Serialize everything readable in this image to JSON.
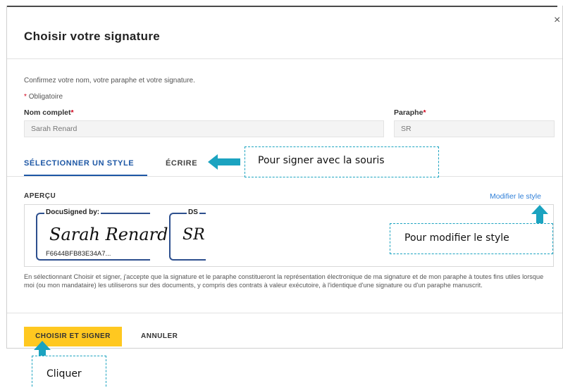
{
  "dialog": {
    "title": "Choisir votre signature",
    "close_symbol": "×",
    "intro": "Confirmez votre nom, votre paraphe et votre signature.",
    "required_star": "*",
    "required_label": "Obligatoire"
  },
  "form": {
    "fullname_label": "Nom complet",
    "fullname_value": "Sarah Renard",
    "initials_label": "Paraphe",
    "initials_value": "SR"
  },
  "tabs": {
    "select_style": "SÉLECTIONNER UN STYLE",
    "write": "ÉCRIRE"
  },
  "preview": {
    "label": "APERÇU",
    "modify_link": "Modifier le style",
    "signature_header": "DocuSigned by:",
    "signature_text": "Sarah Renard",
    "signature_id": "F6644BFB83E34A7...",
    "initials_header": "DS",
    "initials_text": "SR"
  },
  "legal_text": "En sélectionnant Choisir et signer, j'accepte que la signature et le paraphe constitueront la représentation électronique de ma signature et de mon paraphe à toutes fins utiles lorsque moi (ou mon mandataire) les utiliserons sur des documents, y compris des contrats à valeur exécutoire, à l'identique d'une signature ou d'un paraphe manuscrit.",
  "buttons": {
    "confirm": "CHOISIR ET SIGNER",
    "cancel": "ANNULER"
  },
  "annotations": {
    "mouse_sign": "Pour signer avec la souris",
    "modify_style": "Pour modifier le style",
    "click": "Cliquer"
  },
  "colors": {
    "accent_blue": "#1d57a5",
    "link_blue": "#2f7fd8",
    "primary_button": "#ffc820",
    "callout_teal": "#1ba3c0",
    "required_red": "#d0021b"
  },
  "icons": {
    "close": "close-icon",
    "arrow_left": "arrow-left-icon",
    "arrow_up": "arrow-up-icon"
  }
}
